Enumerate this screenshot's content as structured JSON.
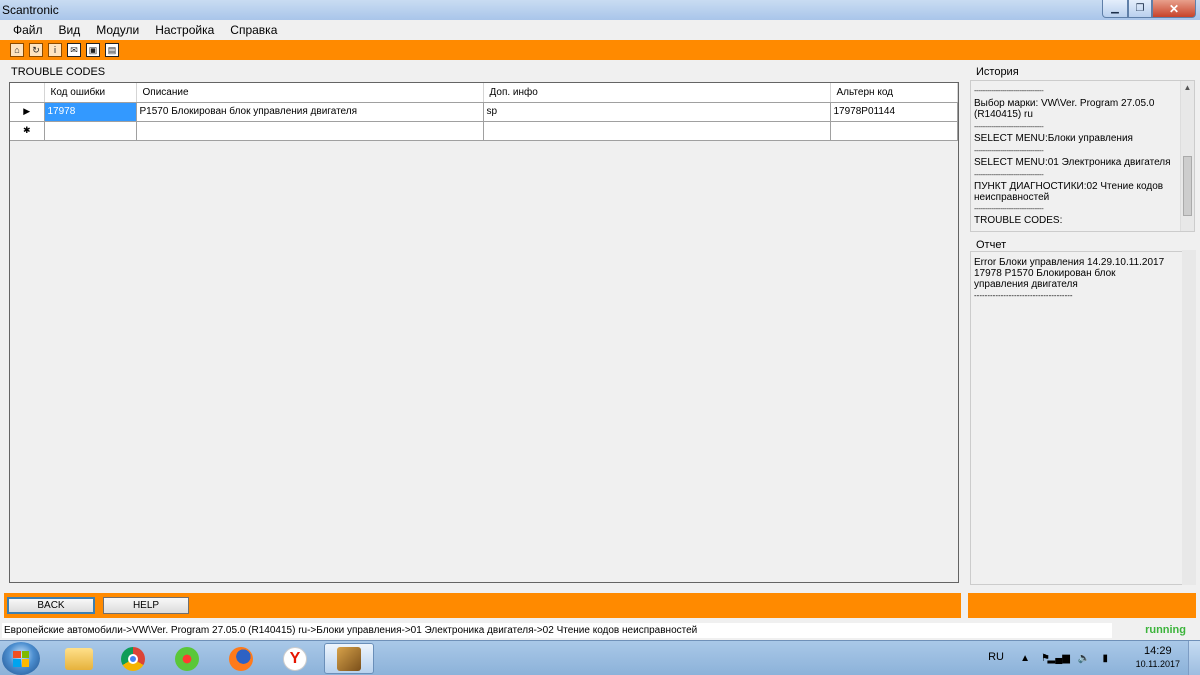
{
  "window": {
    "title": "Scantronic"
  },
  "menu": [
    "Файл",
    "Вид",
    "Модули",
    "Настройка",
    "Справка"
  ],
  "toolbar_icons": [
    "open-icon",
    "refresh-icon",
    "info-icon",
    "mail-icon",
    "card-icon",
    "document-icon"
  ],
  "trouble_codes": {
    "title": "TROUBLE CODES",
    "columns": [
      "Код ошибки",
      "Описание",
      "Доп. инфо",
      "Альтерн код"
    ],
    "rows": [
      {
        "code": "17978",
        "description": "P1570 Блокирован блок управления двигателя",
        "extra": "sp",
        "alt_code": "17978P01144"
      }
    ],
    "current_row_marker": "▶",
    "new_row_marker": "✱"
  },
  "history": {
    "title": "История",
    "separator": "--------------------------------",
    "entries": [
      "Выбор марки: VW\\Ver. Program 27.05.0 (R140415) ru",
      "SELECT MENU:Блоки управления",
      "SELECT MENU:01 Электроника двигателя",
      "ПУНКТ ДИАГНОСТИКИ:02 Чтение кодов неисправностей",
      "TROUBLE CODES:"
    ]
  },
  "report": {
    "title": "Отчет",
    "lines": [
      "Error  Блоки управления 14.29.10.11.2017",
      "17978 P1570 Блокирован блок управления двигателя",
      "-------------------------------------"
    ]
  },
  "buttons": {
    "back": "BACK",
    "help": "HELP"
  },
  "status": {
    "path": "Европейские автомобили->VW\\Ver. Program 27.05.0 (R140415) ru->Блоки управления->01 Электроника двигателя->02 Чтение кодов неисправностей",
    "state": "running"
  },
  "taskbar": {
    "apps": [
      "explorer-icon",
      "chrome-icon",
      "icq-icon",
      "firefox-icon",
      "yandex-icon",
      "scantronic-icon"
    ],
    "language": "RU",
    "time": "14:29",
    "date": "10.11.2017"
  }
}
